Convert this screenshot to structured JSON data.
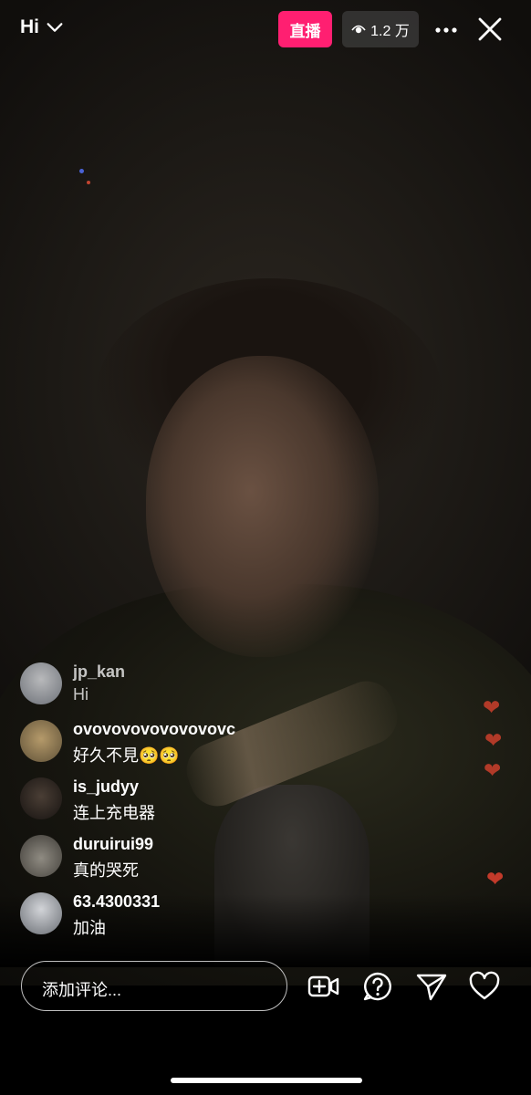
{
  "header": {
    "title": "Hi",
    "live_label": "直播",
    "viewer_count": "1.2 万"
  },
  "comments": [
    {
      "username": "jp_kan",
      "text": "Hi",
      "avatar_color": "#8a8f96",
      "faded": true
    },
    {
      "username": "ovovovovovovovovc",
      "text": "好久不見🥺🥺",
      "avatar_color": "#7a6a4e",
      "faded": false
    },
    {
      "username": "is_judyy",
      "text": "连上充电器",
      "avatar_color": "#2c2622",
      "faded": false
    },
    {
      "username": "duruirui99",
      "text": "真的哭死",
      "avatar_color": "#5c5a54",
      "faded": false
    },
    {
      "username": "63.4300331",
      "text": "加油",
      "avatar_color": "#9a9ea4",
      "faded": false
    }
  ],
  "composer": {
    "placeholder": "添加评论..."
  },
  "icons": {
    "dropdown": "chevron-down-icon",
    "viewers": "eye-icon",
    "more": "more-icon",
    "close": "close-icon",
    "add_guest": "add-video-icon",
    "question": "question-icon",
    "share": "send-icon",
    "like": "heart-icon"
  },
  "colors": {
    "live_badge": "#ff1f71",
    "heart": "#b13a28"
  }
}
